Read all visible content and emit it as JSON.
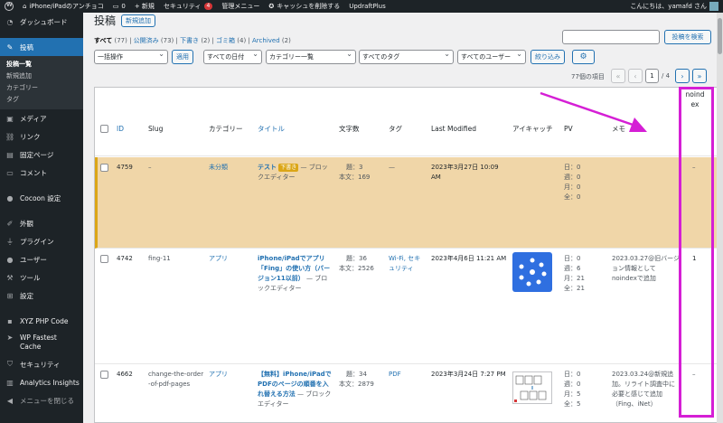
{
  "adminbar": {
    "site_name": "iPhone/iPadのアンチョコ",
    "comments": "0",
    "new": "+ 新規",
    "security": "セキュリティ",
    "security_count": "4",
    "admin_menu": "管理メニュー",
    "clear_cache": "キャッシュを削除する",
    "updraft": "UpdraftPlus",
    "greeting": "こんにちは、yamafd さん"
  },
  "sidebar": {
    "dashboard": "ダッシュボード",
    "posts": "投稿",
    "posts_sub": [
      "投稿一覧",
      "新規追加",
      "カテゴリー",
      "タグ"
    ],
    "media": "メディア",
    "links": "リンク",
    "pages": "固定ページ",
    "comments": "コメント",
    "cocoon": "Cocoon 設定",
    "appearance": "外観",
    "plugins": "プラグイン",
    "users": "ユーザー",
    "tools": "ツール",
    "settings": "設定",
    "xyz": "XYZ PHP Code",
    "wpfc": "WP Fastest Cache",
    "security": "セキュリティ",
    "analytics": "Analytics Insights",
    "collapse": "メニューを閉じる"
  },
  "page": {
    "title": "投稿",
    "add_new": "新規追加",
    "filters": {
      "all": "すべて",
      "all_count": "(77)",
      "published": "公開済み",
      "published_count": "(73)",
      "draft": "下書き",
      "draft_count": "(2)",
      "trash": "ゴミ箱",
      "trash_count": "(4)",
      "archived": "Archived",
      "archived_count": "(2)"
    },
    "search_button": "投稿を検索",
    "bulk_action": "一括操作",
    "apply": "適用",
    "all_dates": "すべての日付",
    "categories": "カテゴリー一覧",
    "all_tags": "すべてのタグ",
    "all_users": "すべてのユーザー",
    "filter": "絞り込み",
    "settings_icon": "gear-icon",
    "item_count": "77個の項目",
    "pagination": {
      "first": "«",
      "prev": "‹",
      "current": "1",
      "total": "/ 4",
      "next": "›",
      "last": "»"
    }
  },
  "table": {
    "headers": {
      "id": "ID",
      "slug": "Slug",
      "category": "カテゴリー",
      "title": "タイトル",
      "wordcount": "文字数",
      "tag": "タグ",
      "modified": "Last Modified",
      "eyecatch": "アイキャッチ",
      "pv": "PV",
      "memo": "メモ",
      "noindex": "noindex"
    },
    "rows": [
      {
        "id": "4759",
        "slug": "–",
        "category": "未分類",
        "title_pre": "テスト",
        "draft": "下書き",
        "title_post": "— ブロックエディター",
        "words_title": "題：3",
        "words_body": "本文：169",
        "tag": "—",
        "modified": "2023年3月27日 10:09 AM",
        "pv": [
          "日：0",
          "週：0",
          "月：0",
          "全：0"
        ],
        "memo": "",
        "noindex": "–"
      },
      {
        "id": "4742",
        "slug": "fing-11",
        "category": "アプリ",
        "title": "iPhone/iPadでアプリ「Fing」の使い方（バージョン11以前）",
        "title_post": "— ブロックエディター",
        "words_title": "題：36",
        "words_body": "本文：2526",
        "tag": "Wi-Fi, セキュリティ",
        "modified": "2023年4月6日 11:21 AM",
        "pv": [
          "日：0",
          "週：6",
          "月：21",
          "全：21"
        ],
        "memo": "2023.03.27@旧バージョン情報としてnoindexで追加",
        "noindex": "1"
      },
      {
        "id": "4662",
        "slug": "change-the-order-of-pdf-pages",
        "category": "アプリ",
        "title": "【無料】iPhone/iPadでPDFのページの順番を入れ替える方法",
        "title_post": "— ブロックエディター",
        "words_title": "題：34",
        "words_body": "本文：2879",
        "tag": "PDF",
        "modified": "2023年3月24日 7:27 PM",
        "pv": [
          "日：0",
          "週：0",
          "月：5",
          "全：5"
        ],
        "memo": "2023.03.24@新規追加。リライト調査中に必要と感じて追加（Fing、iNet）",
        "noindex": "–"
      }
    ]
  },
  "colors": {
    "accent": "#2271b1",
    "highlight": "#d51fd5",
    "draft_row": "#f0d6a8"
  }
}
